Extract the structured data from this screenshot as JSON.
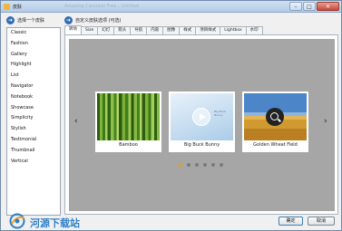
{
  "window": {
    "title": "皮肤",
    "title_ghost": "Amazing Carousel Free - Untitled",
    "controls": {
      "minimize": "–",
      "maximize": "□",
      "close": "✕"
    }
  },
  "header": {
    "left_label": "选择一个皮肤",
    "right_label": "自定义皮肤选项 (可选)"
  },
  "skins": [
    "Classic",
    "Fashion",
    "Gallery",
    "Highlight",
    "List",
    "Navigator",
    "Notebook",
    "Showcase",
    "Simplicity",
    "Stylish",
    "Testimonial",
    "Thumbnail",
    "Vertical"
  ],
  "tabs": [
    "转场",
    "Size",
    "幻灯",
    "箭头",
    "导航",
    "内容",
    "图像",
    "样式",
    "项目样式",
    "Lightbox",
    "水印"
  ],
  "active_tab_index": 0,
  "preview": {
    "items": [
      {
        "caption": "Bamboo"
      },
      {
        "caption": "Big Buck Bunny",
        "thumb_text": "Big Buck Bunny"
      },
      {
        "caption": "Golden Wheat Field"
      }
    ],
    "prev_arrow": "‹",
    "next_arrow": "›",
    "dots": {
      "count": 6,
      "active": 0
    }
  },
  "watermark": {
    "text": "河源下载站"
  },
  "buttons": {
    "ok": "确定",
    "cancel": "取消"
  },
  "colors": {
    "accent": "#2f6db5",
    "stage": "#a6a6a6",
    "active_dot": "#e0a020"
  }
}
